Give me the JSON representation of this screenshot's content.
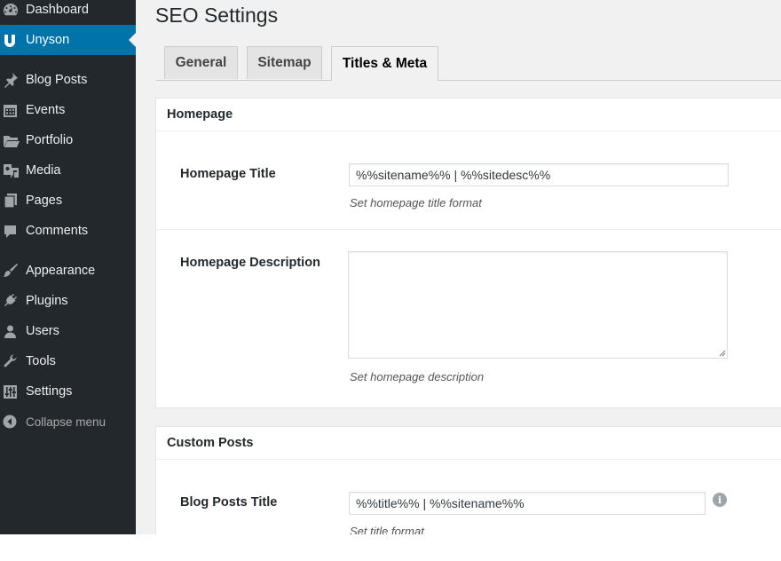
{
  "sidebar": {
    "items": [
      {
        "label": "Dashboard",
        "icon": "dashboard-icon"
      },
      {
        "label": "Unyson",
        "icon": "unyson-icon",
        "active": true
      },
      {
        "label": "Blog Posts",
        "icon": "pin-icon"
      },
      {
        "label": "Events",
        "icon": "calendar-icon"
      },
      {
        "label": "Portfolio",
        "icon": "folder-icon"
      },
      {
        "label": "Media",
        "icon": "media-icon"
      },
      {
        "label": "Pages",
        "icon": "pages-icon"
      },
      {
        "label": "Comments",
        "icon": "comment-icon"
      },
      {
        "label": "Appearance",
        "icon": "brush-icon"
      },
      {
        "label": "Plugins",
        "icon": "plugin-icon"
      },
      {
        "label": "Users",
        "icon": "user-icon"
      },
      {
        "label": "Tools",
        "icon": "wrench-icon"
      },
      {
        "label": "Settings",
        "icon": "settings-icon"
      }
    ],
    "collapse_label": "Collapse menu",
    "colors": {
      "background": "#23282d",
      "active": "#0073aa",
      "text": "#eeeeee"
    }
  },
  "page": {
    "title": "SEO Settings"
  },
  "tabs": [
    {
      "label": "General"
    },
    {
      "label": "Sitemap"
    },
    {
      "label": "Titles & Meta",
      "active": true
    }
  ],
  "homepage_panel": {
    "heading": "Homepage",
    "title_field": {
      "label": "Homepage Title",
      "value": "%%sitename%% | %%sitedesc%%",
      "help": "Set homepage title format"
    },
    "description_field": {
      "label": "Homepage Description",
      "value": "",
      "help": "Set homepage description"
    }
  },
  "custom_posts_panel": {
    "heading": "Custom Posts",
    "blog_title_field": {
      "label": "Blog Posts Title",
      "value": "%%title%% | %%sitename%%",
      "help": "Set title format",
      "info_icon": "info-icon"
    }
  }
}
